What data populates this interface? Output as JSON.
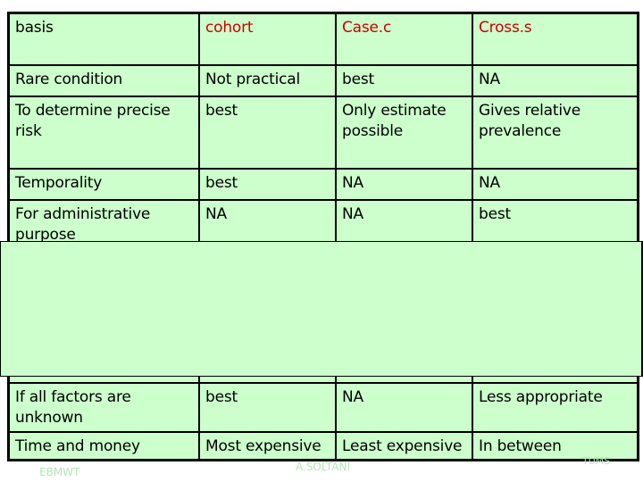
{
  "table": {
    "header": [
      "basis",
      "cohort",
      "Case.c",
      "Cross.s"
    ],
    "rows": [
      [
        "Rare condition",
        "Not practical",
        "best",
        "NA"
      ],
      [
        "To determine precise risk",
        "best",
        "Only estimate possible",
        "Gives relative prevalence"
      ],
      [
        "Temporality",
        "best",
        "NA",
        "NA"
      ],
      [
        "For administrative purpose",
        "NA",
        "NA",
        "best"
      ],
      [
        "If all factors are unknown",
        "best",
        "NA",
        "Less appropriate"
      ],
      [
        "Time and money",
        "Most expensive",
        "Least expensive",
        "In between"
      ]
    ]
  },
  "footer": {
    "left": "EBMWT",
    "center": "A.SOLTANI",
    "right": "TUMS"
  },
  "colors": {
    "table_background": "#ccffcc",
    "header_text": "#cc0000",
    "border": "#000000",
    "footer_text": "#b3e6b3"
  }
}
